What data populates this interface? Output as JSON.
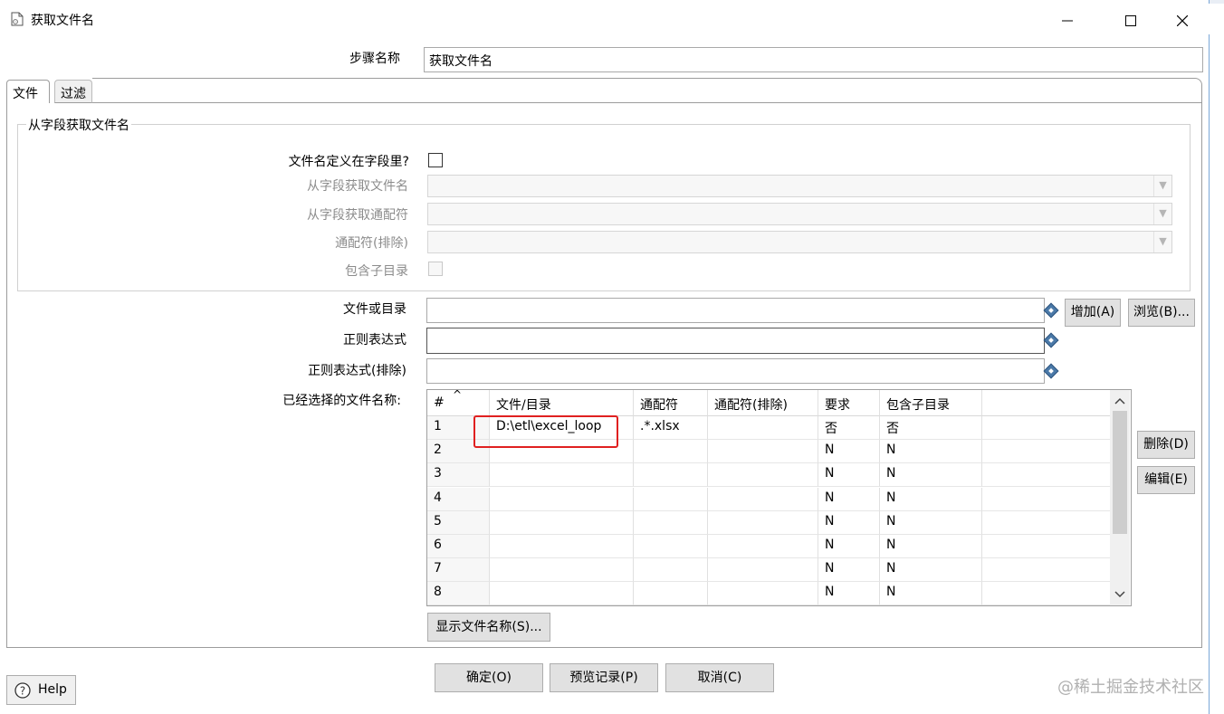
{
  "window": {
    "title": "获取文件名",
    "controls": {
      "minimize": "—",
      "maximize": "☐",
      "close": "✕"
    }
  },
  "step": {
    "label": "步骤名称",
    "value": "获取文件名"
  },
  "tabs": [
    {
      "label": "文件",
      "active": true
    },
    {
      "label": "过滤",
      "active": false
    }
  ],
  "group": {
    "title": "从字段获取文件名",
    "filename_in_field": {
      "label": "文件名定义在字段里?",
      "checked": false
    },
    "field_filename": {
      "label": "从字段获取文件名",
      "value": ""
    },
    "field_wildcard": {
      "label": "从字段获取通配符",
      "value": ""
    },
    "wildcard_exclude": {
      "label": "通配符(排除)",
      "value": ""
    },
    "include_subfolders": {
      "label": "包含子目录",
      "checked": false
    }
  },
  "file_or_dir": {
    "label": "文件或目录",
    "value": "",
    "add_button": "增加(A)",
    "browse_button": "浏览(B)..."
  },
  "regex": {
    "label": "正则表达式",
    "value": ""
  },
  "regex_exclude": {
    "label": "正则表达式(排除)",
    "value": ""
  },
  "selected_files": {
    "label": "已经选择的文件名称:",
    "columns": [
      "#",
      "文件/目录",
      "通配符",
      "通配符(排除)",
      "要求",
      "包含子目录"
    ],
    "rows": [
      [
        "1",
        "D:\\etl\\excel_loop",
        ".*.xlsx",
        "",
        "否",
        "否"
      ],
      [
        "2",
        "",
        "",
        "",
        "N",
        "N"
      ],
      [
        "3",
        "",
        "",
        "",
        "N",
        "N"
      ],
      [
        "4",
        "",
        "",
        "",
        "N",
        "N"
      ],
      [
        "5",
        "",
        "",
        "",
        "N",
        "N"
      ],
      [
        "6",
        "",
        "",
        "",
        "N",
        "N"
      ],
      [
        "7",
        "",
        "",
        "",
        "N",
        "N"
      ],
      [
        "8",
        "",
        "",
        "",
        "N",
        "N"
      ]
    ],
    "delete_button": "删除(D)",
    "edit_button": "编辑(E)",
    "show_filenames_button": "显示文件名称(S)..."
  },
  "footer": {
    "help": "Help",
    "ok": "确定(O)",
    "preview": "预览记录(P)",
    "cancel": "取消(C)"
  },
  "watermark": "@稀土掘金技术社区",
  "colors": {
    "highlight": "#e02020",
    "accent": "#4a79a8"
  }
}
